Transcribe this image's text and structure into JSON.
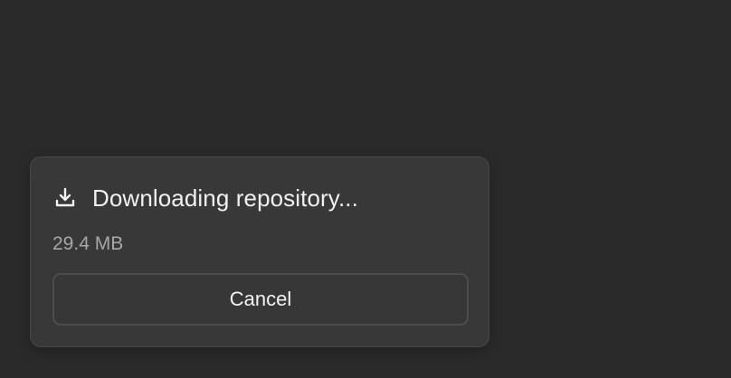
{
  "dialog": {
    "icon": "download-icon",
    "title": "Downloading repository...",
    "size": "29.4 MB",
    "cancel_label": "Cancel"
  },
  "colors": {
    "background": "#2a2a2a",
    "dialog_background": "#383838",
    "text_primary": "#f0f0f0",
    "text_secondary": "#a7a7a7"
  }
}
